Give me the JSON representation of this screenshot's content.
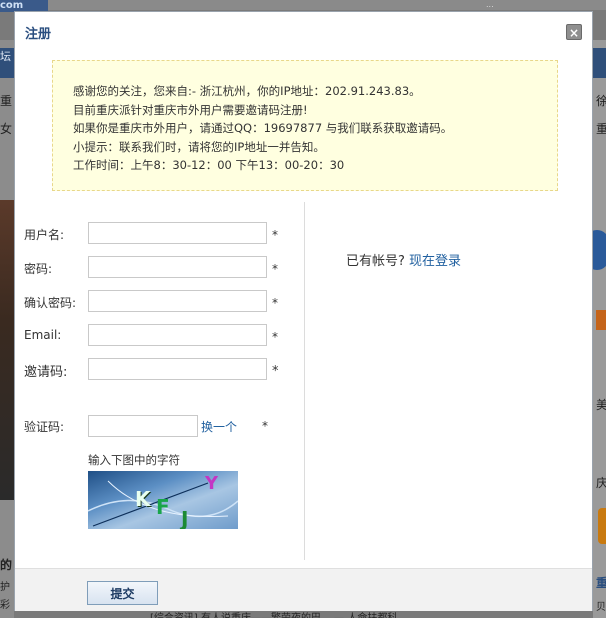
{
  "background": {
    "logo_text": "com",
    "top_right_text": "...",
    "left_texts": [
      "坛",
      "重",
      "女",
      "的",
      "护",
      "彩"
    ],
    "right_texts": [
      "徐",
      "重",
      "美",
      "庆",
      "重",
      "贝"
    ],
    "bottom_text": "[综合资讯] 有人说重庆——繁荣夜的巴。 — 人命扶都科"
  },
  "dialog": {
    "title": "注册",
    "close_label": "×"
  },
  "notice": {
    "lines": [
      "感谢您的关注，您来自:- 浙江杭州，你的IP地址：202.91.243.83。",
      "目前重庆派针对重庆市外用户需要邀请码注册!",
      "如果你是重庆市外用户，请通过QQ：19697877 与我们联系获取邀请码。",
      "小提示：联系我们时，请将您的IP地址一并告知。",
      "工作时间：上午8：30-12：00 下午13：00-20：30"
    ]
  },
  "form": {
    "username_label": "用户名:",
    "password_label": "密码:",
    "confirm_label": "确认密码:",
    "email_label": "Email:",
    "invite_label": "邀请码:",
    "captcha_label": "验证码:",
    "required_mark": "*",
    "swap_link": "换一个",
    "captcha_hint": "输入下图中的字符",
    "captcha_chars": [
      "K",
      "F",
      "J",
      "Y"
    ]
  },
  "login": {
    "prompt": "已有帐号?",
    "link": "现在登录"
  },
  "footer": {
    "submit_label": "提交"
  }
}
